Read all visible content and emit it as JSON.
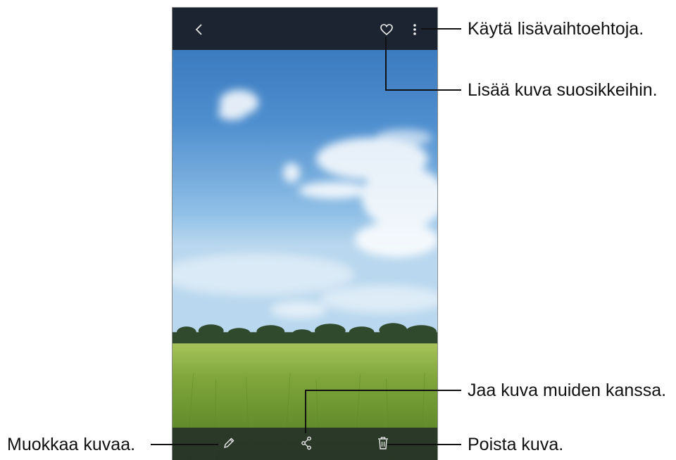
{
  "viewer": {
    "back_icon": "chevron-left-icon",
    "favorite_icon": "heart-outline-icon",
    "more_icon": "more-vertical-icon",
    "edit_icon": "pencil-icon",
    "share_icon": "share-icon",
    "delete_icon": "trash-icon"
  },
  "callouts": {
    "more_options": "Käytä lisävaihtoehtoja.",
    "add_favorite": "Lisää kuva suosikkeihin.",
    "share": "Jaa kuva muiden kanssa.",
    "edit": "Muokkaa kuvaa.",
    "delete": "Poista kuva."
  },
  "colors": {
    "topbar": "#1b2430",
    "callout_line": "#111111"
  }
}
